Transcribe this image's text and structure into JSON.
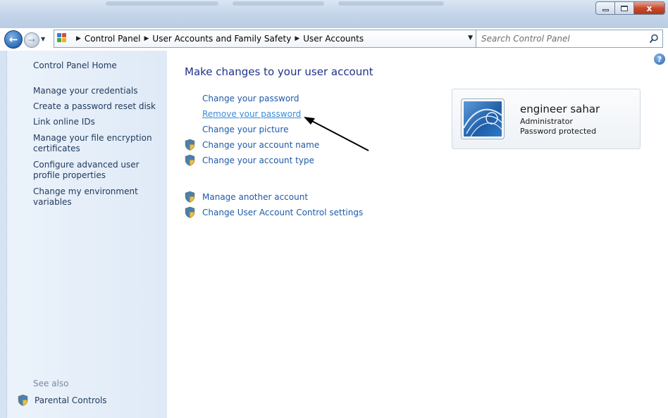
{
  "window": {
    "buttons": {
      "minimize": "minimize",
      "maximize": "maximize",
      "close": "x"
    }
  },
  "nav": {
    "breadcrumbs": [
      "Control Panel",
      "User Accounts and Family Safety",
      "User Accounts"
    ],
    "search_placeholder": "Search Control Panel"
  },
  "sidebar": {
    "home": "Control Panel Home",
    "items": [
      "Manage your credentials",
      "Create a password reset disk",
      "Link online IDs",
      "Manage your file encryption certificates",
      "Configure advanced user profile properties",
      "Change my environment variables"
    ],
    "see_also": "See also",
    "parental_controls": "Parental Controls"
  },
  "main": {
    "title": "Make changes to your user account",
    "tasks": [
      "Change your password",
      "Remove your password",
      "Change your picture"
    ],
    "shield_tasks": [
      "Change your account name",
      "Change your account type"
    ],
    "other_tasks": [
      "Manage another account",
      "Change User Account Control settings"
    ]
  },
  "account": {
    "name": "engineer sahar",
    "role": "Administrator",
    "status": "Password protected"
  },
  "colors": {
    "link": "#1e5aa8",
    "title": "#1e3287",
    "sidebar_bg": "#e6eff9"
  }
}
